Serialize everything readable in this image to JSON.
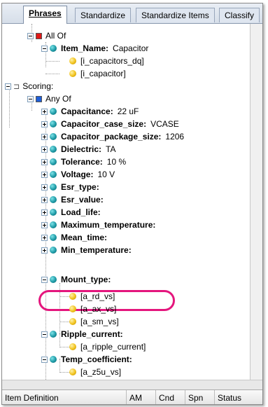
{
  "tabs": [
    "Phrases",
    "Standardize",
    "Standardize Items",
    "Classify"
  ],
  "tree": {
    "all_of": "All Of",
    "item_name": {
      "label": "Item_Name:",
      "value": "Capacitor"
    },
    "item_name_children": [
      "[i_capacitors_dq]",
      "[i_capacitor]"
    ],
    "scoring": "Scoring:",
    "any_of": "Any Of",
    "properties": [
      {
        "label": "Capacitance:",
        "value": "22 uF"
      },
      {
        "label": "Capacitor_case_size:",
        "value": "VCASE"
      },
      {
        "label": "Capacitor_package_size:",
        "value": "1206"
      },
      {
        "label": "Dielectric:",
        "value": "TA"
      },
      {
        "label": "Tolerance:",
        "value": "10 %"
      },
      {
        "label": "Voltage:",
        "value": "10 V"
      },
      {
        "label": "Esr_type:",
        "value": ""
      },
      {
        "label": "Esr_value:",
        "value": ""
      },
      {
        "label": "Load_life:",
        "value": ""
      },
      {
        "label": "Maximum_temperature:",
        "value": ""
      },
      {
        "label": "Mean_time:",
        "value": ""
      },
      {
        "label": "Min_temperature:",
        "value": ""
      }
    ],
    "mount_type": "Mount_type:",
    "mount_type_children": [
      "[a_rd_vs]",
      "[a_ax_vs]",
      "[a_sm_vs]"
    ],
    "ripple_current": "Ripple_current:",
    "ripple_current_children": [
      "[a_ripple_current]"
    ],
    "temp_coefficient": "Temp_coefficient:",
    "temp_coefficient_children": [
      "[a_z5u_vs]"
    ]
  },
  "columns": [
    "Item Definition",
    "AM",
    "Cnd",
    "Spn",
    "Status"
  ],
  "colors": {
    "highlight": "#e4167d",
    "node": "#1d9aa6",
    "leaf": "#f1c21c"
  }
}
